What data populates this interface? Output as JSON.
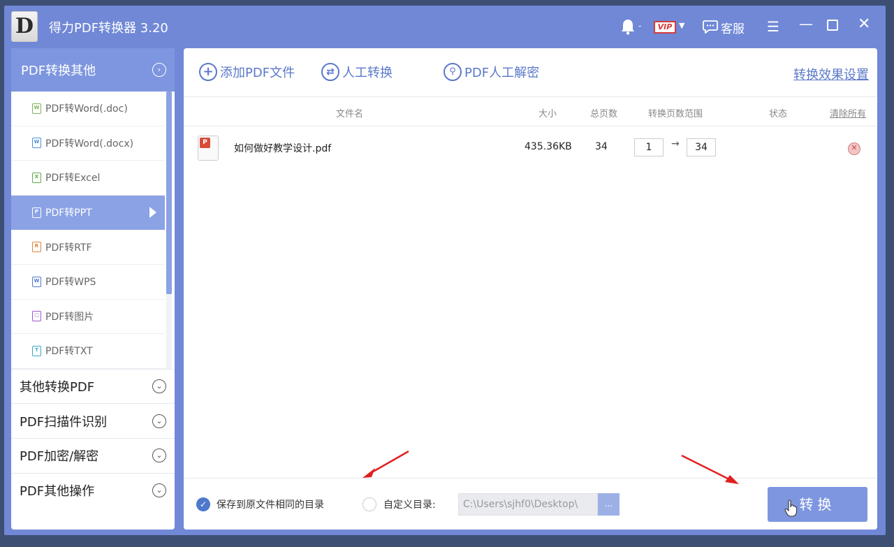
{
  "app": {
    "logo_letter": "D",
    "title": "得力PDF转换器 3.20",
    "vip_label": "VIP",
    "service_label": "客服"
  },
  "sidebar": {
    "header": "PDF转换其他",
    "items": [
      {
        "label": "PDF转Word(.doc)",
        "icon": "word-doc-icon",
        "color": "#7fb35a"
      },
      {
        "label": "PDF转Word(.docx)",
        "icon": "word-docx-icon",
        "color": "#4e8fd6"
      },
      {
        "label": "PDF转Excel",
        "icon": "excel-icon",
        "color": "#5faa4b"
      },
      {
        "label": "PDF转PPT",
        "icon": "ppt-icon",
        "color": "#ffffff"
      },
      {
        "label": "PDF转RTF",
        "icon": "rtf-icon",
        "color": "#e0823a"
      },
      {
        "label": "PDF转WPS",
        "icon": "wps-icon",
        "color": "#4e78cc"
      },
      {
        "label": "PDF转图片",
        "icon": "image-icon",
        "color": "#9b59c9"
      },
      {
        "label": "PDF转TXT",
        "icon": "txt-icon",
        "color": "#3aa6c9"
      }
    ],
    "active_index": 3,
    "groups": [
      {
        "label": "其他转换PDF"
      },
      {
        "label": "PDF扫描件识别"
      },
      {
        "label": "PDF加密/解密"
      },
      {
        "label": "PDF其他操作"
      }
    ]
  },
  "toolbar": {
    "add_pdf": "添加PDF文件",
    "manual_convert": "人工转换",
    "manual_decrypt": "PDF人工解密",
    "settings_link": "转换效果设置"
  },
  "table": {
    "headers": {
      "filename": "文件名",
      "size": "大小",
      "pages": "总页数",
      "range": "转换页数范围",
      "status": "状态",
      "clear_all": "清除所有"
    },
    "rows": [
      {
        "filename": "如何做好教学设计.pdf",
        "size": "435.36KB",
        "pages": "34",
        "range_from": "1",
        "range_to": "34",
        "status": ""
      }
    ]
  },
  "footer": {
    "same_dir_label": "保存到原文件相同的目录",
    "custom_dir_label": "自定义目录:",
    "path_value": "C:\\Users\\sjhf0\\Desktop\\",
    "browse_label": "...",
    "convert_label": "转换"
  },
  "colors": {
    "window_bg": "#7088d6",
    "accent": "#5b78c9",
    "active_item": "#8ba2e5",
    "annotation": "#e02020"
  }
}
